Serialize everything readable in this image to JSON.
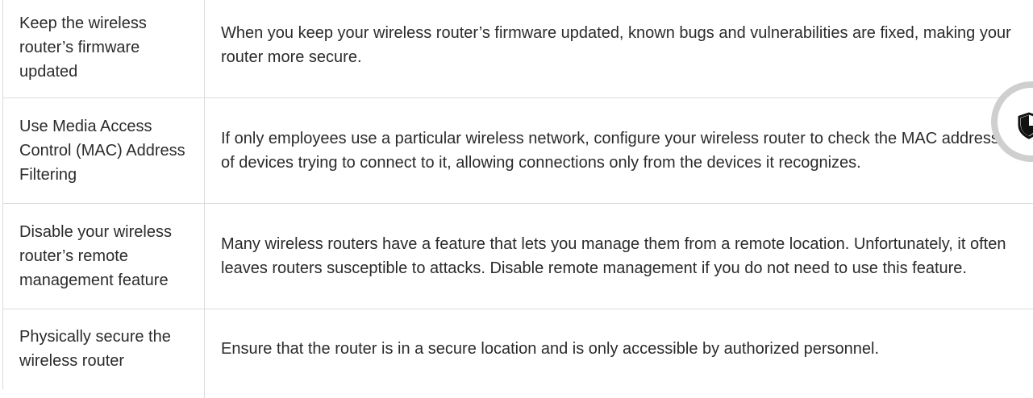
{
  "rows": [
    {
      "term": "Keep the wireless router’s firmware updated",
      "description": "When you keep your wireless router’s firmware updated, known bugs and vulnerabilities are fixed, making your router more secure."
    },
    {
      "term": "Use Media Access Control (MAC) Address Filtering",
      "description": "If only employees use a particular wireless network, configure your wireless router to check the MAC addresses of devices trying to connect to it, allowing connections only from the devices it recognizes."
    },
    {
      "term": "Disable your wireless router’s remote management feature",
      "description": "Many wireless routers have a feature that lets you manage them from a remote location. Unfortunately, it often leaves routers susceptible to attacks. Disable remote management if you do not need to use this feature."
    },
    {
      "term": "Physically secure the wireless router",
      "description": "Ensure that the router is in a secure location and is only accessible by authorized personnel."
    }
  ],
  "floating_button": {
    "icon": "shield-icon"
  },
  "colors": {
    "border": "#dcdcdc",
    "text": "#2b2b2b",
    "fab_ring": "#cfcfcf"
  }
}
